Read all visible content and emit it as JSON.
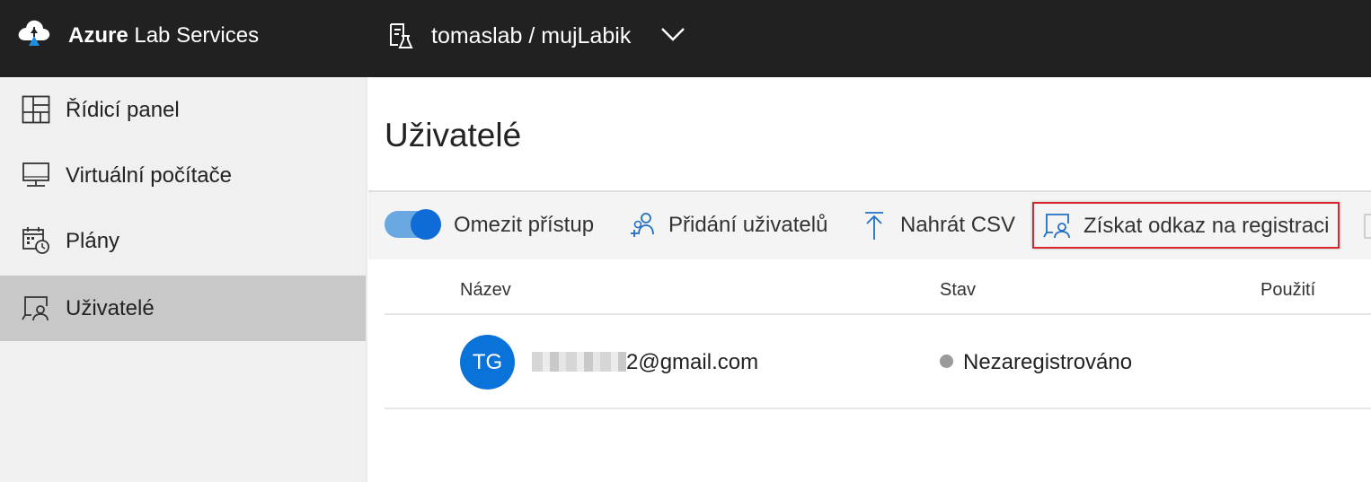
{
  "header": {
    "brand_bold": "Azure",
    "brand_rest": " Lab Services",
    "lab_name": "tomaslab / mujLabik"
  },
  "sidebar": {
    "items": [
      {
        "label": "Řídicí panel",
        "icon": "dashboard-icon"
      },
      {
        "label": "Virtuální počítače",
        "icon": "monitor-icon"
      },
      {
        "label": "Plány",
        "icon": "calendar-clock-icon"
      },
      {
        "label": "Uživatelé",
        "icon": "users-board-icon",
        "selected": true
      }
    ]
  },
  "main": {
    "title": "Uživatelé",
    "toolbar": {
      "restrict_label": "Omezit přístup",
      "restrict_enabled": true,
      "add_users_label": "Přidání uživatelů",
      "upload_csv_label": "Nahrát CSV",
      "get_link_label": "Získat odkaz na registraci"
    },
    "table": {
      "columns": [
        "Název",
        "Stav",
        "Použití"
      ],
      "rows": [
        {
          "initials": "TG",
          "email_visible": "2@gmail.com",
          "status": "Nezaregistrováno"
        }
      ]
    }
  },
  "colors": {
    "topbar": "#212121",
    "accent": "#0f6cd6",
    "highlight": "#d9262e",
    "status_unregistered": "#9a9a9a"
  }
}
